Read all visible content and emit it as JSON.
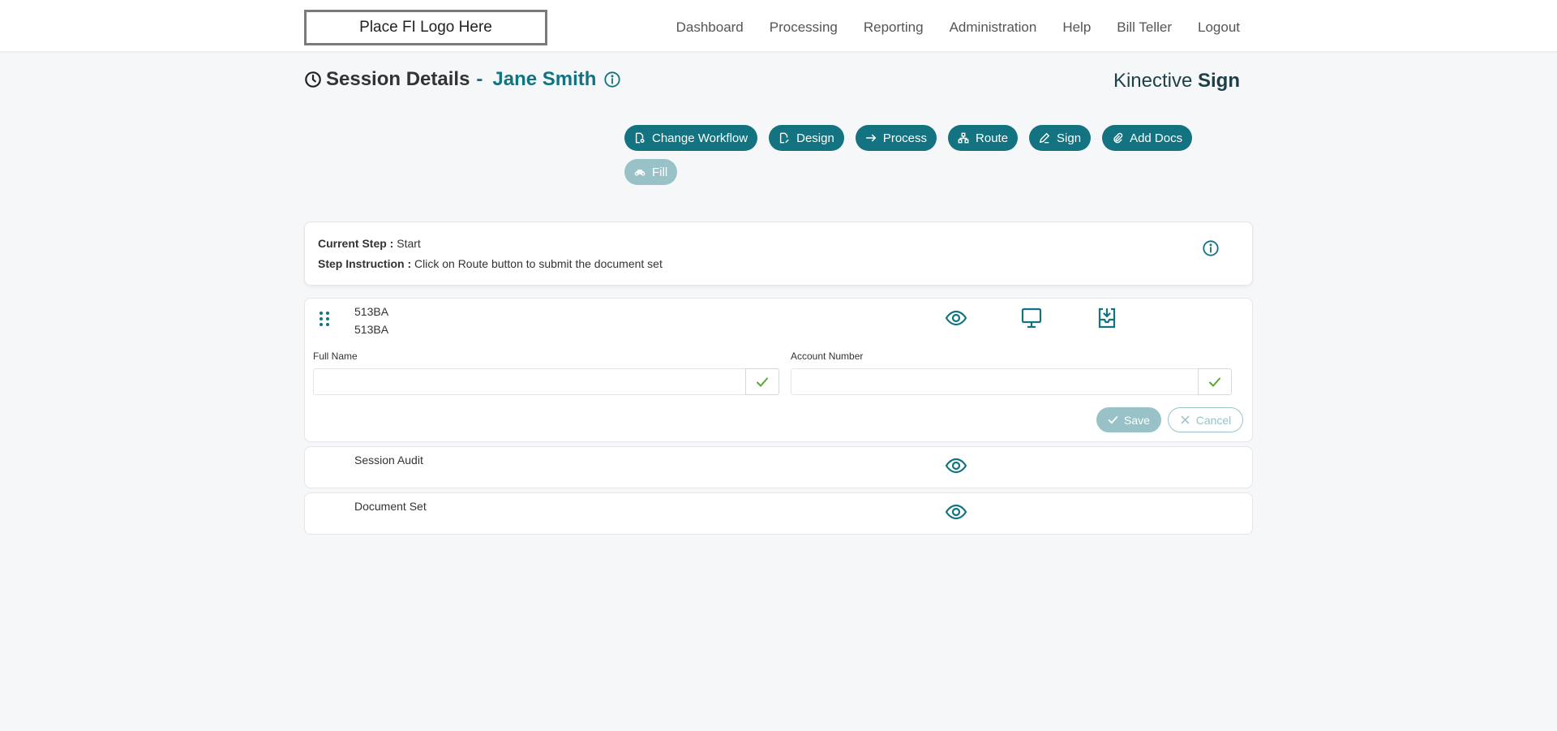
{
  "header": {
    "logo_text": "Place FI Logo Here",
    "nav": [
      "Dashboard",
      "Processing",
      "Reporting",
      "Administration",
      "Help",
      "Bill Teller",
      "Logout"
    ]
  },
  "page": {
    "title": "Session Details",
    "separator": "-",
    "customer_name": "Jane Smith",
    "brand_light": "Kinective",
    "brand_bold": "Sign"
  },
  "actions": {
    "change_workflow": "Change Workflow",
    "design": "Design",
    "process": "Process",
    "route": "Route",
    "sign": "Sign",
    "add_docs": "Add Docs",
    "fill": "Fill"
  },
  "step": {
    "current_label": "Current Step :",
    "current_value": "Start",
    "instruction_label": "Step Instruction :",
    "instruction_value": "Click on Route button to submit the document set"
  },
  "document": {
    "name_line1": "513BA",
    "name_line2": "513BA",
    "full_name_label": "Full Name",
    "full_name_value": "",
    "account_number_label": "Account Number",
    "account_number_value": "",
    "save_label": "Save",
    "cancel_label": "Cancel"
  },
  "sections": {
    "audit": "Session Audit",
    "docset": "Document Set"
  },
  "colors": {
    "accent": "#137380",
    "accent_disabled": "#98c2c8",
    "check": "#5aa832"
  }
}
